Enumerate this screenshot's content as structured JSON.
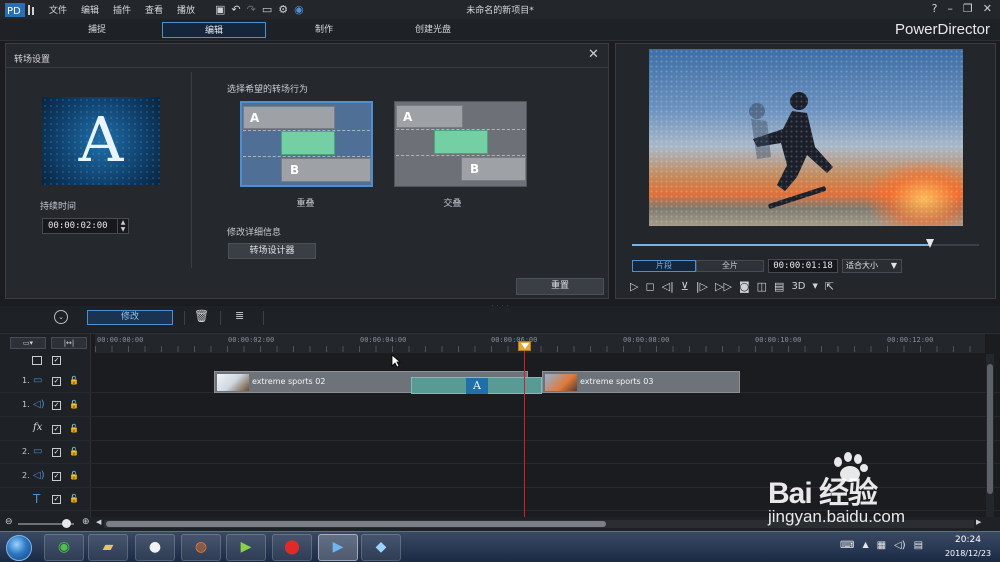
{
  "menubar": {
    "items": [
      "文件",
      "编辑",
      "插件",
      "查看",
      "播放"
    ],
    "title": "未命名的新项目*"
  },
  "modes": {
    "tabs": [
      "捕捉",
      "编辑",
      "制作",
      "创建光盘"
    ],
    "active": 1,
    "brand": "PowerDirector"
  },
  "transition_panel": {
    "title": "转场设置",
    "thumb_letter": "A",
    "duration_label": "持续时间",
    "duration_value": "00:00:02:00",
    "behavior_label": "选择希望的转场行为",
    "option_overlap": "重叠",
    "option_cross": "交叠",
    "letter_a": "A",
    "letter_b": "B",
    "modify_details_label": "修改详细信息",
    "designer_button": "转场设计器",
    "reset_button": "重置"
  },
  "preview": {
    "mode_clip": "片段",
    "mode_full": "全片",
    "timecode": "00:00:01:18",
    "fit_label": "适合大小",
    "three_d": "3D",
    "scrub_fraction": 0.86
  },
  "edit_toolbar": {
    "modify_button": "修改"
  },
  "timeline": {
    "ruler_labels": [
      "00:00:00:00",
      "00:00:02:00",
      "00:00:04:00",
      "00:00:06:00",
      "00:00:08:00",
      "00:00:10:00",
      "00:00:12:00"
    ],
    "tracks": [
      {
        "num": "1.",
        "kind": "video"
      },
      {
        "num": "1.",
        "kind": "audio"
      },
      {
        "num": "",
        "kind": "fx"
      },
      {
        "num": "2.",
        "kind": "video"
      },
      {
        "num": "2.",
        "kind": "audio"
      },
      {
        "num": "",
        "kind": "title"
      }
    ],
    "clips": {
      "clip1": "extreme sports 02",
      "clip2": "extreme sports 03"
    },
    "transition_letter": "A"
  },
  "taskbar": {
    "time": "20:24",
    "date": "2018/12/23"
  },
  "watermark": {
    "text": "Bai 经验",
    "url": "jingyan.baidu.com"
  },
  "colors": {
    "accent": "#4d8fd1",
    "transition_green": "#74d0a4",
    "playhead": "#d2202a"
  }
}
